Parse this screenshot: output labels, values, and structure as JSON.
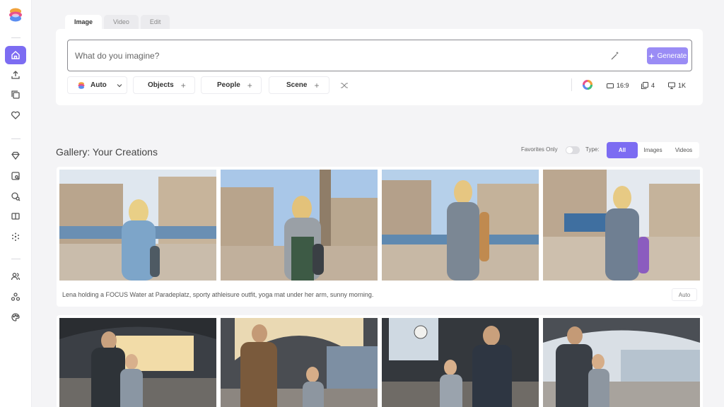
{
  "colors": {
    "accent": "#7c6cf2",
    "generate": "#9a8cf5",
    "background": "#f4f4f6"
  },
  "sidebar": {
    "logo": "app-logo",
    "items": [
      {
        "icon": "home-icon",
        "active": true
      },
      {
        "icon": "upload-icon"
      },
      {
        "icon": "copy-icon"
      },
      {
        "icon": "heart-icon"
      },
      {
        "icon": "diamond-icon"
      },
      {
        "icon": "image-search-icon"
      },
      {
        "icon": "face-search-icon"
      },
      {
        "icon": "book-icon"
      },
      {
        "icon": "sparkle-dots-icon"
      },
      {
        "icon": "users-icon"
      },
      {
        "icon": "network-icon"
      },
      {
        "icon": "palette-icon"
      }
    ]
  },
  "tabs": [
    "Image",
    "Video",
    "Edit"
  ],
  "prompt": {
    "placeholder": "What do you imagine?",
    "value": ""
  },
  "generate_label": "Generate",
  "chips": {
    "auto": "Auto",
    "objects": "Objects",
    "people": "People",
    "scene": "Scene"
  },
  "controls": {
    "aspect": "16:9",
    "count": "4",
    "resolution": "1K"
  },
  "gallery": {
    "title": "Gallery: Your Creations",
    "favorites_label": "Favorites Only",
    "favorites_on": false,
    "type_label": "Type:",
    "types": [
      "All",
      "Images",
      "Videos"
    ],
    "selected_type": "All",
    "cards": [
      {
        "caption": "Lena holding a FOCUS Water at Paradeplatz, sporty athleisure outfit, yoga mat under her arm, sunny morning.",
        "tag": "Auto",
        "images": [
          "woman-square-photo",
          "woman-square-photo",
          "woman-square-photo",
          "woman-square-photo"
        ]
      },
      {
        "caption": "",
        "tag": "",
        "images": [
          "station-photo",
          "station-photo",
          "station-photo",
          "station-photo"
        ]
      }
    ]
  }
}
